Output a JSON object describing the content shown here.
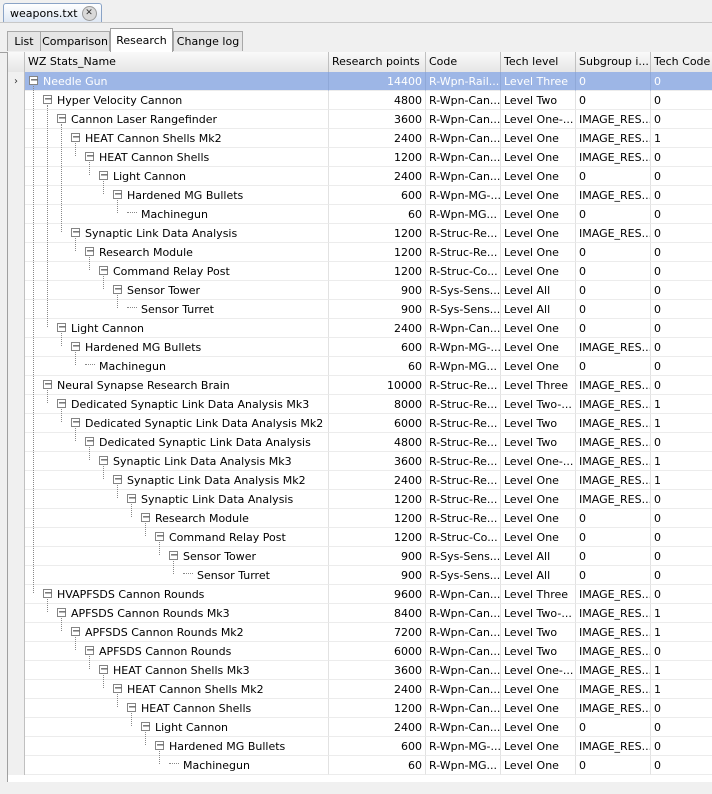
{
  "document_tab": {
    "title": "weapons.txt"
  },
  "view_tabs": [
    {
      "label": "List",
      "active": false
    },
    {
      "label": "Comparison",
      "active": false
    },
    {
      "label": "Research",
      "active": true
    },
    {
      "label": "Change log",
      "active": false
    }
  ],
  "columns": [
    "WZ Stats_Name",
    "Research points",
    "Code",
    "Tech level",
    "Subgroup i...",
    "Tech Code"
  ],
  "rows": [
    {
      "depth": 0,
      "name": "Needle Gun",
      "points": "14400",
      "code": "R-Wpn-Rail...",
      "level": "Level Three",
      "subgroup": "0",
      "tech": "0",
      "selected": true,
      "leaf": false
    },
    {
      "depth": 1,
      "name": "Hyper Velocity Cannon",
      "points": "4800",
      "code": "R-Wpn-Can...",
      "level": "Level Two",
      "subgroup": "0",
      "tech": "0",
      "leaf": false
    },
    {
      "depth": 2,
      "name": "Cannon Laser Rangefinder",
      "points": "3600",
      "code": "R-Wpn-Can...",
      "level": "Level One-...",
      "subgroup": "IMAGE_RES...",
      "tech": "0",
      "leaf": false
    },
    {
      "depth": 3,
      "name": "HEAT Cannon Shells Mk2",
      "points": "2400",
      "code": "R-Wpn-Can...",
      "level": "Level One",
      "subgroup": "IMAGE_RES...",
      "tech": "1",
      "leaf": false
    },
    {
      "depth": 4,
      "name": "HEAT Cannon Shells",
      "points": "1200",
      "code": "R-Wpn-Can...",
      "level": "Level One",
      "subgroup": "IMAGE_RES...",
      "tech": "0",
      "leaf": false
    },
    {
      "depth": 5,
      "name": "Light Cannon",
      "points": "2400",
      "code": "R-Wpn-Can...",
      "level": "Level One",
      "subgroup": "0",
      "tech": "0",
      "leaf": false
    },
    {
      "depth": 6,
      "name": "Hardened MG Bullets",
      "points": "600",
      "code": "R-Wpn-MG-...",
      "level": "Level One",
      "subgroup": "IMAGE_RES...",
      "tech": "0",
      "leaf": false
    },
    {
      "depth": 7,
      "name": "Machinegun",
      "points": "60",
      "code": "R-Wpn-MG...",
      "level": "Level One",
      "subgroup": "0",
      "tech": "0",
      "leaf": true
    },
    {
      "depth": 3,
      "name": "Synaptic Link Data Analysis",
      "points": "1200",
      "code": "R-Struc-Re...",
      "level": "Level One",
      "subgroup": "IMAGE_RES...",
      "tech": "0",
      "leaf": false
    },
    {
      "depth": 4,
      "name": "Research Module",
      "points": "1200",
      "code": "R-Struc-Re...",
      "level": "Level One",
      "subgroup": "0",
      "tech": "0",
      "leaf": false
    },
    {
      "depth": 5,
      "name": "Command Relay Post",
      "points": "1200",
      "code": "R-Struc-Co...",
      "level": "Level One",
      "subgroup": "0",
      "tech": "0",
      "leaf": false
    },
    {
      "depth": 6,
      "name": "Sensor Tower",
      "points": "900",
      "code": "R-Sys-Sens...",
      "level": "Level All",
      "subgroup": "0",
      "tech": "0",
      "leaf": false
    },
    {
      "depth": 7,
      "name": "Sensor Turret",
      "points": "900",
      "code": "R-Sys-Sens...",
      "level": "Level All",
      "subgroup": "0",
      "tech": "0",
      "leaf": true
    },
    {
      "depth": 2,
      "name": "Light Cannon",
      "points": "2400",
      "code": "R-Wpn-Can...",
      "level": "Level One",
      "subgroup": "0",
      "tech": "0",
      "leaf": false
    },
    {
      "depth": 3,
      "name": "Hardened MG Bullets",
      "points": "600",
      "code": "R-Wpn-MG-...",
      "level": "Level One",
      "subgroup": "IMAGE_RES...",
      "tech": "0",
      "leaf": false
    },
    {
      "depth": 4,
      "name": "Machinegun",
      "points": "60",
      "code": "R-Wpn-MG...",
      "level": "Level One",
      "subgroup": "0",
      "tech": "0",
      "leaf": true
    },
    {
      "depth": 1,
      "name": "Neural Synapse Research Brain",
      "points": "10000",
      "code": "R-Struc-Re...",
      "level": "Level Three",
      "subgroup": "IMAGE_RES...",
      "tech": "0",
      "leaf": false
    },
    {
      "depth": 2,
      "name": "Dedicated Synaptic Link Data Analysis Mk3",
      "points": "8000",
      "code": "R-Struc-Re...",
      "level": "Level Two-...",
      "subgroup": "IMAGE_RES...",
      "tech": "1",
      "leaf": false
    },
    {
      "depth": 3,
      "name": "Dedicated Synaptic Link Data Analysis Mk2",
      "points": "6000",
      "code": "R-Struc-Re...",
      "level": "Level Two",
      "subgroup": "IMAGE_RES...",
      "tech": "1",
      "leaf": false
    },
    {
      "depth": 4,
      "name": "Dedicated Synaptic Link Data Analysis",
      "points": "4800",
      "code": "R-Struc-Re...",
      "level": "Level Two",
      "subgroup": "IMAGE_RES...",
      "tech": "0",
      "leaf": false
    },
    {
      "depth": 5,
      "name": "Synaptic Link Data Analysis Mk3",
      "points": "3600",
      "code": "R-Struc-Re...",
      "level": "Level One-...",
      "subgroup": "IMAGE_RES...",
      "tech": "1",
      "leaf": false
    },
    {
      "depth": 6,
      "name": "Synaptic Link Data Analysis Mk2",
      "points": "2400",
      "code": "R-Struc-Re...",
      "level": "Level One",
      "subgroup": "IMAGE_RES...",
      "tech": "1",
      "leaf": false
    },
    {
      "depth": 7,
      "name": "Synaptic Link Data Analysis",
      "points": "1200",
      "code": "R-Struc-Re...",
      "level": "Level One",
      "subgroup": "IMAGE_RES...",
      "tech": "0",
      "leaf": false
    },
    {
      "depth": 8,
      "name": "Research Module",
      "points": "1200",
      "code": "R-Struc-Re...",
      "level": "Level One",
      "subgroup": "0",
      "tech": "0",
      "leaf": false
    },
    {
      "depth": 9,
      "name": "Command Relay Post",
      "points": "1200",
      "code": "R-Struc-Co...",
      "level": "Level One",
      "subgroup": "0",
      "tech": "0",
      "leaf": false
    },
    {
      "depth": 10,
      "name": "Sensor Tower",
      "points": "900",
      "code": "R-Sys-Sens...",
      "level": "Level All",
      "subgroup": "0",
      "tech": "0",
      "leaf": false
    },
    {
      "depth": 11,
      "name": "Sensor Turret",
      "points": "900",
      "code": "R-Sys-Sens...",
      "level": "Level All",
      "subgroup": "0",
      "tech": "0",
      "leaf": true
    },
    {
      "depth": 1,
      "name": "HVAPFSDS Cannon Rounds",
      "points": "9600",
      "code": "R-Wpn-Can...",
      "level": "Level Three",
      "subgroup": "IMAGE_RES...",
      "tech": "0",
      "leaf": false
    },
    {
      "depth": 2,
      "name": "APFSDS Cannon Rounds Mk3",
      "points": "8400",
      "code": "R-Wpn-Can...",
      "level": "Level Two-...",
      "subgroup": "IMAGE_RES...",
      "tech": "1",
      "leaf": false
    },
    {
      "depth": 3,
      "name": "APFSDS Cannon Rounds Mk2",
      "points": "7200",
      "code": "R-Wpn-Can...",
      "level": "Level Two",
      "subgroup": "IMAGE_RES...",
      "tech": "1",
      "leaf": false
    },
    {
      "depth": 4,
      "name": "APFSDS Cannon Rounds",
      "points": "6000",
      "code": "R-Wpn-Can...",
      "level": "Level Two",
      "subgroup": "IMAGE_RES...",
      "tech": "0",
      "leaf": false
    },
    {
      "depth": 5,
      "name": "HEAT Cannon Shells Mk3",
      "points": "3600",
      "code": "R-Wpn-Can...",
      "level": "Level One-...",
      "subgroup": "IMAGE_RES...",
      "tech": "1",
      "leaf": false
    },
    {
      "depth": 6,
      "name": "HEAT Cannon Shells Mk2",
      "points": "2400",
      "code": "R-Wpn-Can...",
      "level": "Level One",
      "subgroup": "IMAGE_RES...",
      "tech": "1",
      "leaf": false
    },
    {
      "depth": 7,
      "name": "HEAT Cannon Shells",
      "points": "1200",
      "code": "R-Wpn-Can...",
      "level": "Level One",
      "subgroup": "IMAGE_RES...",
      "tech": "0",
      "leaf": false
    },
    {
      "depth": 8,
      "name": "Light Cannon",
      "points": "2400",
      "code": "R-Wpn-Can...",
      "level": "Level One",
      "subgroup": "0",
      "tech": "0",
      "leaf": false
    },
    {
      "depth": 9,
      "name": "Hardened MG Bullets",
      "points": "600",
      "code": "R-Wpn-MG-...",
      "level": "Level One",
      "subgroup": "IMAGE_RES...",
      "tech": "0",
      "leaf": false
    },
    {
      "depth": 10,
      "name": "Machinegun",
      "points": "60",
      "code": "R-Wpn-MG...",
      "level": "Level One",
      "subgroup": "0",
      "tech": "0",
      "leaf": true
    }
  ],
  "colors": {
    "selection": "#9db6e6",
    "grid_line": "#e2e2e2",
    "header": "#e6e6e6"
  }
}
